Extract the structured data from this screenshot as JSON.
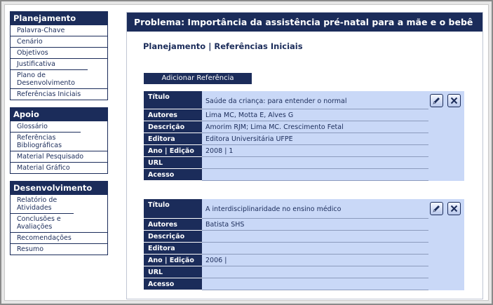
{
  "sidebar": {
    "sections": [
      {
        "title": "Planejamento",
        "items": [
          "Palavra-Chave",
          "Cenário",
          "Objetivos",
          "Justificativa",
          "Plano de Desenvolvimento",
          "Referências Iniciais"
        ]
      },
      {
        "title": "Apoio",
        "items": [
          "Glossário",
          "Referências Bibliográficas",
          "Material Pesquisado",
          "Material Gráfico"
        ]
      },
      {
        "title": "Desenvolvimento",
        "items": [
          "Relatório de Atividades",
          "Conclusões e Avaliações",
          "Recomendações",
          "Resumo"
        ]
      }
    ]
  },
  "main": {
    "title": "Problema: Importância da assistência pré-natal para a mãe e o bebê",
    "subtitle": "Planejamento | Referências Iniciais",
    "add_button": "Adicionar Referência"
  },
  "field_labels": {
    "titulo": "Título",
    "autores": "Autores",
    "descricao": "Descrição",
    "editora": "Editora",
    "ano_edicao": "Ano | Edição",
    "url": "URL",
    "acesso": "Acesso"
  },
  "references": [
    {
      "titulo": "Saúde da criança: para entender o normal",
      "autores": "Lima MC, Motta E, Alves G",
      "descricao": "Amorim RJM; Lima MC. Crescimento Fetal",
      "editora": "Editora Universitária UFPE",
      "ano_edicao": "2008 | 1",
      "url": "",
      "acesso": ""
    },
    {
      "titulo": "A interdisciplinaridade no ensino médico",
      "autores": "Batista SHS",
      "descricao": "",
      "editora": "",
      "ano_edicao": "2006 |",
      "url": "",
      "acesso": ""
    }
  ],
  "icons": {
    "edit": "pencil-icon",
    "delete": "close-icon"
  },
  "colors": {
    "navy": "#1b2c5a",
    "light_blue": "#c9d8f7"
  }
}
